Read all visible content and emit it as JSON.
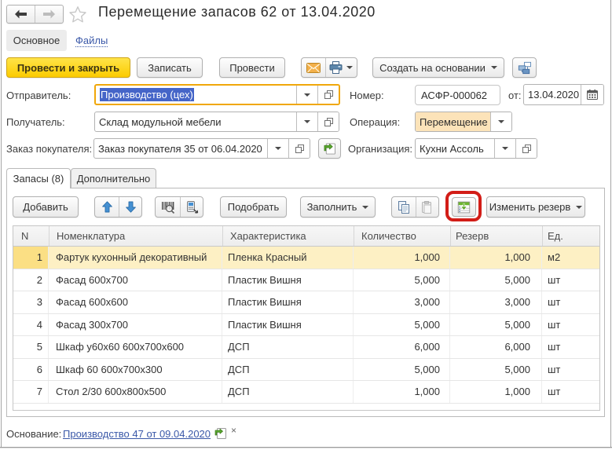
{
  "header": {
    "title": "Перемещение запасов 62 от 13.04.2020",
    "tabs": {
      "main": "Основное",
      "files": "Файлы"
    }
  },
  "command_bar": {
    "post_and_close": "Провести и закрыть",
    "save": "Записать",
    "post": "Провести",
    "icons": [
      "envelope-icon",
      "printer-icon",
      "related-documents-icon"
    ],
    "create_based_on": "Создать на основании"
  },
  "form": {
    "sender": {
      "label": "Отправитель:",
      "value": "Производство (цех)",
      "focused": true,
      "selected_text": true
    },
    "receiver": {
      "label": "Получатель:",
      "value": "Склад модульной мебели"
    },
    "customer_order": {
      "label": "Заказ покупателя:",
      "value": "Заказ покупателя 35 от 06.04.2020"
    },
    "number": {
      "label": "Номер:",
      "value": "АСФР-000062"
    },
    "date": {
      "label": "от:",
      "value": "13.04.2020"
    },
    "operation": {
      "label": "Операция:",
      "value": "Перемещение"
    },
    "organization": {
      "label": "Организация:",
      "value": "Кухни Ассоль"
    }
  },
  "tabs": {
    "inventory": "Запасы (8)",
    "additional": "Дополнительно"
  },
  "table_toolbar": {
    "add": "Добавить",
    "pick": "Подобрать",
    "fill": "Заполнить",
    "change_reserve": "Изменить резерв",
    "icons": [
      "move-up-icon",
      "move-down-icon",
      "barcode-scan-icon",
      "data-terminal-icon",
      "copy-icon",
      "paste-icon",
      "reserve-table-icon"
    ]
  },
  "table": {
    "columns": [
      "N",
      "Номенклатура",
      "Характеристика",
      "Количество",
      "Резерв",
      "Ед."
    ],
    "selected_row_index": 0,
    "rows": [
      {
        "n": "1",
        "nomenclature": "Фартук кухонный декоративный",
        "characteristic": "Пленка Красный",
        "quantity": "1,000",
        "reserve": "1,000",
        "unit": "м2"
      },
      {
        "n": "2",
        "nomenclature": "Фасад 600х700",
        "characteristic": "Пластик Вишня",
        "quantity": "5,000",
        "reserve": "5,000",
        "unit": "шт"
      },
      {
        "n": "3",
        "nomenclature": "Фасад 600х600",
        "characteristic": "Пластик Вишня",
        "quantity": "3,000",
        "reserve": "3,000",
        "unit": "шт"
      },
      {
        "n": "4",
        "nomenclature": "Фасад 300х700",
        "characteristic": "Пластик Вишня",
        "quantity": "5,000",
        "reserve": "5,000",
        "unit": "шт"
      },
      {
        "n": "5",
        "nomenclature": "Шкаф у60х60 600х700х600",
        "characteristic": "ДСП",
        "quantity": "6,000",
        "reserve": "6,000",
        "unit": "шт"
      },
      {
        "n": "6",
        "nomenclature": "Шкаф 60 600х700х300",
        "characteristic": "ДСП",
        "quantity": "5,000",
        "reserve": "5,000",
        "unit": "шт"
      },
      {
        "n": "7",
        "nomenclature": "Стол 2/30 600х800х500",
        "characteristic": "ДСП",
        "quantity": "1,000",
        "reserve": "1,000",
        "unit": "шт"
      }
    ]
  },
  "footer": {
    "label": "Основание:",
    "link": "Производство 47 от 09.04.2020",
    "close": "×"
  },
  "colors": {
    "accent_yellow_top": "#ffe448",
    "accent_yellow_bottom": "#fbcb00",
    "focus_border": "#f0a70a",
    "selection_blue": "#4565c8",
    "row_highlight": "#fdf0c4",
    "current_cell": "#fbdf84",
    "operation_field_bg": "#fce3b9",
    "annotation_red": "#d21d17",
    "link_blue": "#3a58a8"
  }
}
